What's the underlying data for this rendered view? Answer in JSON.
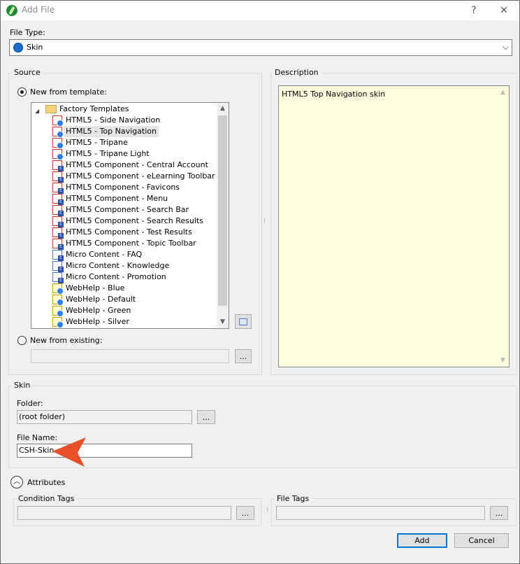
{
  "window": {
    "title": "Add File",
    "help_label": "?",
    "close_label": "✕"
  },
  "file_type": {
    "label": "File Type:",
    "value": "Skin"
  },
  "source": {
    "group_label": "Source",
    "new_from_template_label": "New from template:",
    "new_from_existing_label": "New from existing:",
    "tree_root": "Factory Templates",
    "tree_items": [
      {
        "label": "HTML5 - Side Navigation",
        "icon": "html5-skin-icon"
      },
      {
        "label": "HTML5 - Top Navigation",
        "icon": "html5-skin-icon",
        "selected": true
      },
      {
        "label": "HTML5 - Tripane",
        "icon": "html5-skin-icon"
      },
      {
        "label": "HTML5 - Tripane Light",
        "icon": "html5-skin-icon"
      },
      {
        "label": "HTML5 Component - Central Account",
        "icon": "html5-component-icon"
      },
      {
        "label": "HTML5 Component - eLearning Toolbar",
        "icon": "html5-component-icon"
      },
      {
        "label": "HTML5 Component - Favicons",
        "icon": "html5-component-icon"
      },
      {
        "label": "HTML5 Component - Menu",
        "icon": "html5-component-icon"
      },
      {
        "label": "HTML5 Component - Search Bar",
        "icon": "html5-component-icon"
      },
      {
        "label": "HTML5 Component - Search Results",
        "icon": "html5-component-icon"
      },
      {
        "label": "HTML5 Component - Test Results",
        "icon": "html5-component-icon"
      },
      {
        "label": "HTML5 Component - Topic Toolbar",
        "icon": "html5-component-icon"
      },
      {
        "label": "Micro Content - FAQ",
        "icon": "micro-content-icon"
      },
      {
        "label": "Micro Content - Knowledge",
        "icon": "micro-content-icon"
      },
      {
        "label": "Micro Content - Promotion",
        "icon": "micro-content-icon"
      },
      {
        "label": "WebHelp - Blue",
        "icon": "webhelp-skin-icon"
      },
      {
        "label": "WebHelp - Default",
        "icon": "webhelp-skin-icon"
      },
      {
        "label": "WebHelp - Green",
        "icon": "webhelp-skin-icon"
      },
      {
        "label": "WebHelp - Silver",
        "icon": "webhelp-skin-icon"
      }
    ],
    "browse_label": "..."
  },
  "description": {
    "group_label": "Description",
    "text": "HTML5 Top Navigation skin"
  },
  "skin": {
    "group_label": "Skin",
    "folder_label": "Folder:",
    "folder_value": "(root folder)",
    "browse_label": "...",
    "file_name_label": "File Name:",
    "file_name_value": "CSH-Skin"
  },
  "attributes": {
    "label": "Attributes",
    "condition_tags_label": "Condition Tags",
    "file_tags_label": "File Tags",
    "browse_label": "..."
  },
  "buttons": {
    "add": "Add",
    "cancel": "Cancel"
  },
  "colors": {
    "annotation_arrow": "#e8502a",
    "description_bg": "#ffffe0"
  }
}
